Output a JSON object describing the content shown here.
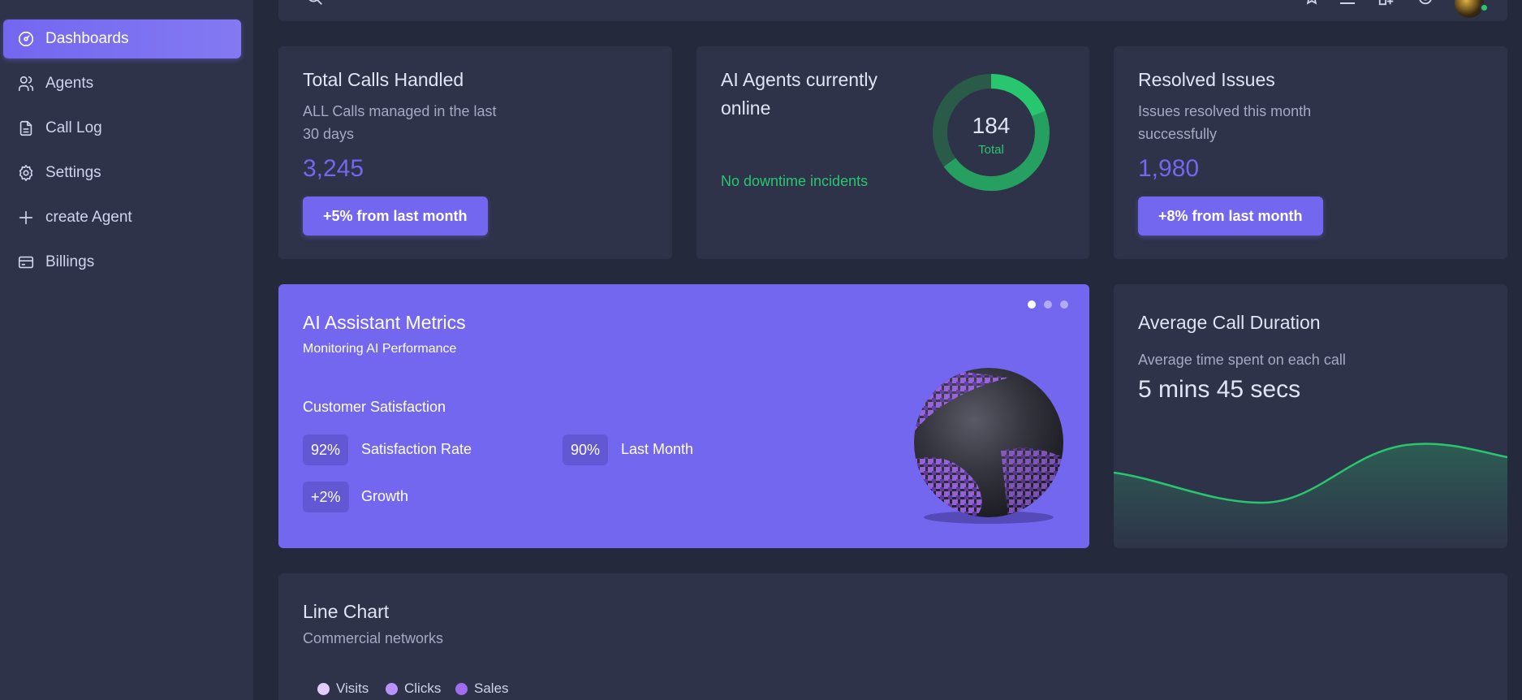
{
  "sidebar": {
    "items": [
      {
        "label": "Dashboards",
        "icon": "gauge-icon",
        "active": true
      },
      {
        "label": "Agents",
        "icon": "users-icon"
      },
      {
        "label": "Call Log",
        "icon": "document-icon"
      },
      {
        "label": "Settings",
        "icon": "gear-icon"
      },
      {
        "label": "create Agent",
        "icon": "plus-icon"
      },
      {
        "label": "Billings",
        "icon": "credit-card-icon"
      }
    ]
  },
  "topbar": {
    "icons": [
      "search-icon",
      "star-icon",
      "menu-icon",
      "add-user-icon",
      "settings-icon"
    ],
    "avatar_status": "online"
  },
  "cards": {
    "total_calls": {
      "title": "Total Calls Handled",
      "subtitle_line1": "ALL Calls managed in the last",
      "subtitle_line2": "30 days",
      "value": "3,245",
      "button": "+5% from last month"
    },
    "agents_online": {
      "title_line1": "AI Agents currently",
      "title_line2": "online",
      "status": "No downtime incidents",
      "donut_value": "184",
      "donut_label": "Total",
      "donut_fraction": 0.19
    },
    "resolved": {
      "title": "Resolved Issues",
      "subtitle_line1": "Issues resolved this month",
      "subtitle_line2": "successfully",
      "value": "1,980",
      "button": "+8% from last month"
    },
    "metrics": {
      "title": "AI Assistant Metrics",
      "subtitle": "Monitoring AI Performance",
      "section": "Customer Satisfaction",
      "chips": [
        {
          "value": "92%",
          "label": "Satisfaction Rate"
        },
        {
          "value": "90%",
          "label": "Last Month"
        },
        {
          "value": "+2%",
          "label": "Growth"
        }
      ],
      "carousel_active": 0,
      "carousel_count": 3
    },
    "call_duration": {
      "title": "Average Call Duration",
      "subtitle": "Average time spent on each call",
      "value": "5 mins 45 secs"
    },
    "line_chart": {
      "title": "Line Chart",
      "subtitle": "Commercial networks",
      "legend": [
        {
          "label": "Visits",
          "color": "#e0cffe"
        },
        {
          "label": "Clicks",
          "color": "#b992fe"
        },
        {
          "label": "Sales",
          "color": "#a06cf0"
        }
      ]
    }
  },
  "colors": {
    "primary": "#7367f0",
    "success": "#28c76f",
    "card": "#2f3349",
    "background": "#25293c"
  }
}
